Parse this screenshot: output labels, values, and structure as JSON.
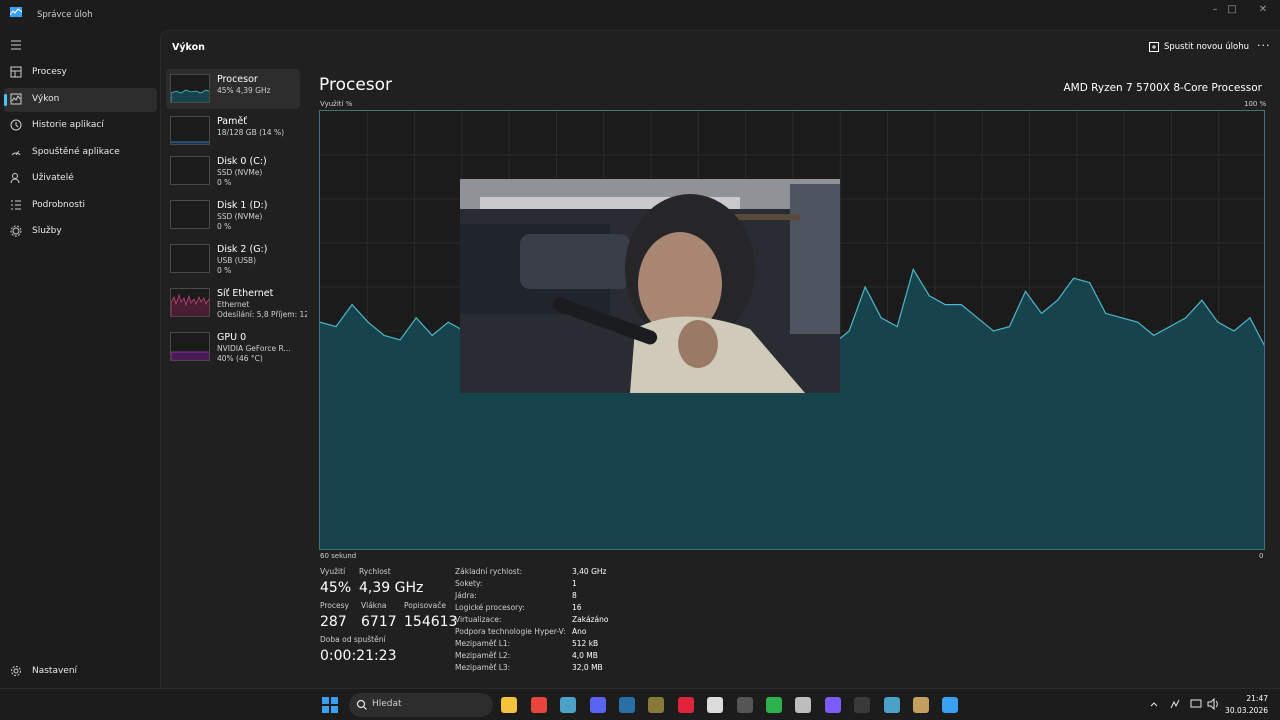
{
  "window": {
    "title": "Správce úloh",
    "controls": [
      "–",
      "□",
      "✕"
    ]
  },
  "nav": {
    "items": [
      {
        "label": "Procesy",
        "icon": "grid-icon"
      },
      {
        "label": "Výkon",
        "icon": "performance-icon",
        "active": true
      },
      {
        "label": "Historie aplikací",
        "icon": "history-icon"
      },
      {
        "label": "Spouštěné aplikace",
        "icon": "startup-icon"
      },
      {
        "label": "Uživatelé",
        "icon": "users-icon"
      },
      {
        "label": "Podrobnosti",
        "icon": "details-icon"
      },
      {
        "label": "Služby",
        "icon": "services-icon"
      }
    ],
    "settings_label": "Nastavení"
  },
  "header": {
    "title": "Výkon",
    "run_task_label": "Spustit novou úlohu",
    "more_label": "···"
  },
  "devices": [
    {
      "name": "Procesor",
      "line2": "45% 4,39 GHz",
      "line3": "",
      "color": "#2fa7b8",
      "active": true
    },
    {
      "name": "Paměť",
      "line2": "18/128 GB (14 %)",
      "line3": "",
      "color": "#3d8fd6"
    },
    {
      "name": "Disk 0 (C:)",
      "line2": "SSD (NVMe)",
      "line3": "0 %",
      "color": "#6a9f3a"
    },
    {
      "name": "Disk 1 (D:)",
      "line2": "SSD (NVMe)",
      "line3": "0 %",
      "color": "#6a9f3a"
    },
    {
      "name": "Disk 2 (G:)",
      "line2": "USB (USB)",
      "line3": "0 %",
      "color": "#6a9f3a"
    },
    {
      "name": "Síť Ethernet",
      "line2": "Ethernet",
      "line3": "Odesílání: 5,8 Příjem: 12",
      "color": "#c2457a"
    },
    {
      "name": "GPU 0",
      "line2": "NVIDIA GeForce R...",
      "line3": "40% (46 °C)",
      "color": "#9c3ab3"
    }
  ],
  "detail": {
    "title": "Procesor",
    "model": "AMD Ryzen 7 5700X 8-Core Processor",
    "y_label": "Využití %",
    "y_max_label": "100 %",
    "x_label": "60 sekund",
    "x_min_label": "0",
    "fill_color": "#17434c",
    "line_color": "#4db7c9",
    "stats": {
      "usage_label": "Využití",
      "usage_value": "45%",
      "speed_label": "Rychlost",
      "speed_value": "4,39 GHz",
      "processes_label": "Procesy",
      "processes_value": "287",
      "threads_label": "Vlákna",
      "threads_value": "6717",
      "handles_label": "Popisovače",
      "handles_value": "154613",
      "uptime_label": "Doba od spuštění",
      "uptime_value": "0:00:21:23"
    },
    "specs": [
      {
        "key": "Základní rychlost:",
        "value": "3,40 GHz"
      },
      {
        "key": "Sokety:",
        "value": "1"
      },
      {
        "key": "Jádra:",
        "value": "8"
      },
      {
        "key": "Logické procesory:",
        "value": "16"
      },
      {
        "key": "Virtualizace:",
        "value": "Zakázáno"
      },
      {
        "key": "Podpora technologie Hyper-V:",
        "value": "Ano"
      },
      {
        "key": "Mezipaměť L1:",
        "value": "512 kB"
      },
      {
        "key": "Mezipaměť L2:",
        "value": "4,0 MB"
      },
      {
        "key": "Mezipaměť L3:",
        "value": "32,0 MB"
      }
    ]
  },
  "chart_data": {
    "type": "area",
    "ylabel": "Využití %",
    "xlabel": "60 sekund",
    "ylim": [
      0,
      100
    ],
    "xlim": [
      60,
      0
    ],
    "x": [
      60,
      59,
      58,
      57,
      56,
      55,
      54,
      53,
      52,
      51,
      50,
      49,
      48,
      47,
      46,
      45,
      44,
      43,
      42,
      41,
      40,
      39,
      38,
      37,
      36,
      35,
      34,
      33,
      32,
      31,
      30,
      29,
      28,
      27,
      26,
      25,
      24,
      23,
      22,
      21,
      20,
      19,
      18,
      17,
      16,
      15,
      14,
      13,
      12,
      11,
      10,
      9,
      8,
      7,
      6,
      5,
      4,
      3,
      2,
      1,
      0
    ],
    "values": [
      52,
      51,
      56,
      52,
      49,
      48,
      53,
      49,
      52,
      50,
      47,
      48,
      50,
      49,
      48,
      47,
      47,
      46,
      47,
      46,
      48,
      47,
      46,
      48,
      47,
      47,
      46,
      47,
      47,
      46,
      47,
      48,
      47,
      50,
      60,
      53,
      51,
      64,
      58,
      56,
      56,
      53,
      50,
      51,
      59,
      54,
      57,
      62,
      61,
      54,
      53,
      52,
      49,
      51,
      53,
      57,
      52,
      50,
      53,
      46
    ]
  },
  "overlay": {
    "icon": "webcam-video-overlay"
  },
  "taskbar": {
    "search_label": "Hledat",
    "apps": [
      {
        "name": "start-icon",
        "color": "#3aa0f3"
      },
      {
        "name": "explorer-icon",
        "color": "#f2c43d"
      },
      {
        "name": "chrome-icon",
        "color": "#e8453c"
      },
      {
        "name": "desktop-icon",
        "color": "#4aa3c7"
      },
      {
        "name": "discord-icon",
        "color": "#5865f2"
      },
      {
        "name": "steam-icon",
        "color": "#2a6fa5"
      },
      {
        "name": "photo-app-icon",
        "color": "#8a7a3a"
      },
      {
        "name": "opera-icon",
        "color": "#e0243b"
      },
      {
        "name": "chatgpt-icon",
        "color": "#dcdcdc"
      },
      {
        "name": "epic-icon",
        "color": "#555555"
      },
      {
        "name": "xbox-icon",
        "color": "#2bb24c"
      },
      {
        "name": "obs-icon",
        "color": "#bdbdbd"
      },
      {
        "name": "grid-app-icon",
        "color": "#7a5cff"
      },
      {
        "name": "terminal-icon",
        "color": "#3a3a3a"
      },
      {
        "name": "anchor-icon",
        "color": "#4aa3c7"
      },
      {
        "name": "game-icon",
        "color": "#c2a060"
      },
      {
        "name": "taskmanager-icon",
        "color": "#3aa0f3"
      }
    ],
    "time": "21:47",
    "date": "30.03.2026"
  }
}
